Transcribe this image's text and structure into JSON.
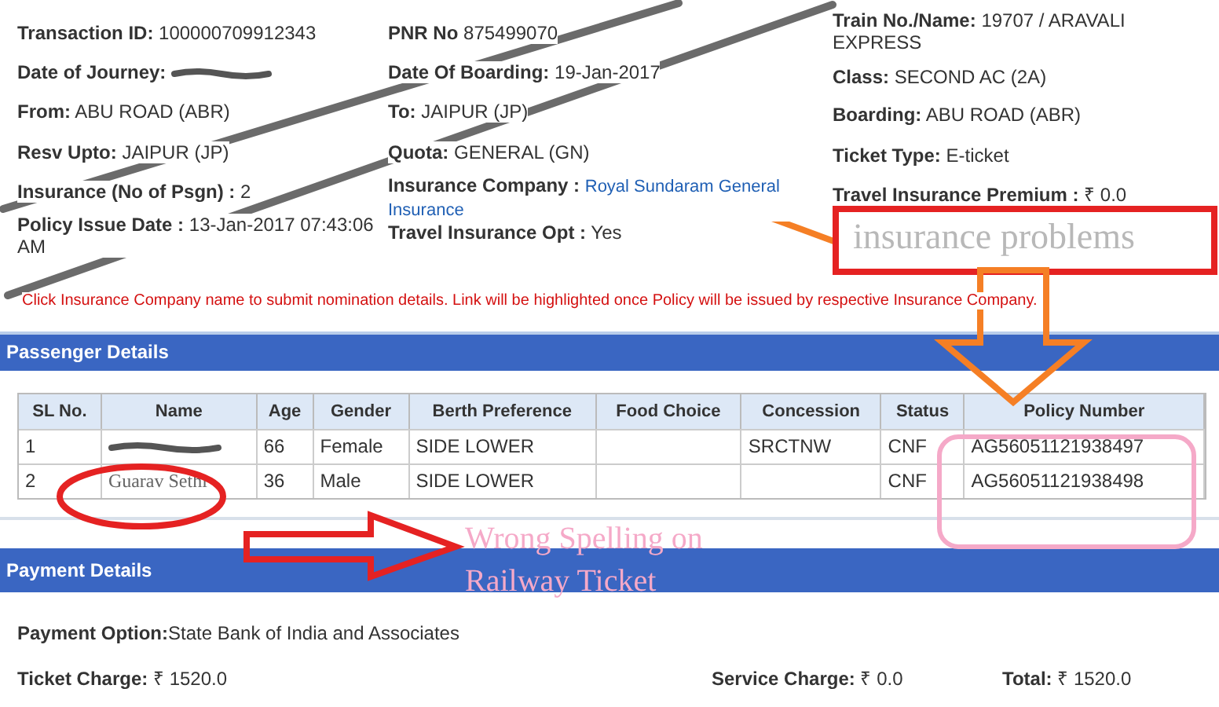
{
  "booking": {
    "columns": [
      [
        {
          "label": "Transaction ID:",
          "value": "100000709912343",
          "kind": "text",
          "redacted": false
        },
        {
          "label": "Date of Journey:",
          "redacted": true
        },
        {
          "label": "From:",
          "value": "ABU ROAD (ABR)",
          "kind": "text",
          "redacted": false
        },
        {
          "label": "Resv Upto:",
          "value": "JAIPUR (JP)",
          "kind": "text",
          "redacted": false
        },
        {
          "label": "Insurance (No of Psgn) :",
          "value": "2",
          "kind": "text",
          "redacted": false
        },
        {
          "label": "Policy Issue Date :",
          "value": "13-Jan-2017 07:43:06 AM",
          "kind": "text",
          "redacted": false
        }
      ],
      [
        {
          "label": "PNR No",
          "value": "875499070",
          "kind": "text",
          "redacted": false
        },
        {
          "label": "Date Of Boarding:",
          "value": "19-Jan-2017",
          "kind": "text",
          "redacted": false
        },
        {
          "label": "To:",
          "value": "JAIPUR (JP)",
          "kind": "text",
          "redacted": false
        },
        {
          "label": "Quota:",
          "value": "GENERAL (GN)",
          "kind": "text",
          "redacted": false
        },
        {
          "label": "Insurance Company :",
          "value": "Royal Sundaram General Insurance",
          "kind": "link",
          "redacted": false
        },
        {
          "label": "Travel Insurance Opt :",
          "value": "Yes",
          "kind": "text",
          "redacted": false
        }
      ],
      [
        {
          "label": "Train No./Name:",
          "value": "19707 /  ARAVALI EXPRESS",
          "kind": "text",
          "redacted": false
        },
        {
          "label": "Class:",
          "value": "SECOND AC (2A)",
          "kind": "text",
          "redacted": false
        },
        {
          "label": "Boarding:",
          "value": "ABU ROAD (ABR)",
          "kind": "text",
          "redacted": false
        },
        {
          "label": "Ticket Type:",
          "value": "E-ticket",
          "kind": "text",
          "redacted": false
        },
        {
          "label": "Travel Insurance Premium :",
          "value": "₹ 0.0",
          "kind": "text",
          "redacted": false
        }
      ]
    ]
  },
  "notice": "Click Insurance Company name to submit nomination details. Link will be highlighted once Policy will be issued by respective Insurance Company.",
  "passenger_details": {
    "title": "Passenger Details",
    "columns": [
      "SL No.",
      "Name",
      "Age",
      "Gender",
      "Berth Preference",
      "Food Choice",
      "Concession",
      "Status",
      "Policy Number"
    ],
    "rows": [
      {
        "cells": [
          "1",
          "",
          "66",
          "Female",
          "SIDE LOWER",
          "",
          "SRCTNW",
          "CNF",
          "AG56051121938497"
        ],
        "name_redacted": true
      },
      {
        "cells": [
          "2",
          "Guarav Sethi",
          "36",
          "Male",
          "SIDE LOWER",
          "",
          "",
          "CNF",
          "AG56051121938498"
        ],
        "name_redacted": false
      }
    ]
  },
  "payment_details": {
    "title": "Payment Details",
    "payment_option": {
      "label": "Payment Option:",
      "value": "State Bank of India and Associates"
    },
    "charges": [
      {
        "label": "Ticket Charge:",
        "value": "₹ 1520.0"
      },
      {
        "label": "Service Charge:",
        "value": "₹ 0.0"
      },
      {
        "label": "Total:",
        "value": "₹ 1520.0"
      }
    ]
  },
  "annotations": {
    "insurance_note": "insurance problems",
    "spelling_note_lines": [
      "Wrong Spelling on",
      "Railway Ticket"
    ]
  }
}
